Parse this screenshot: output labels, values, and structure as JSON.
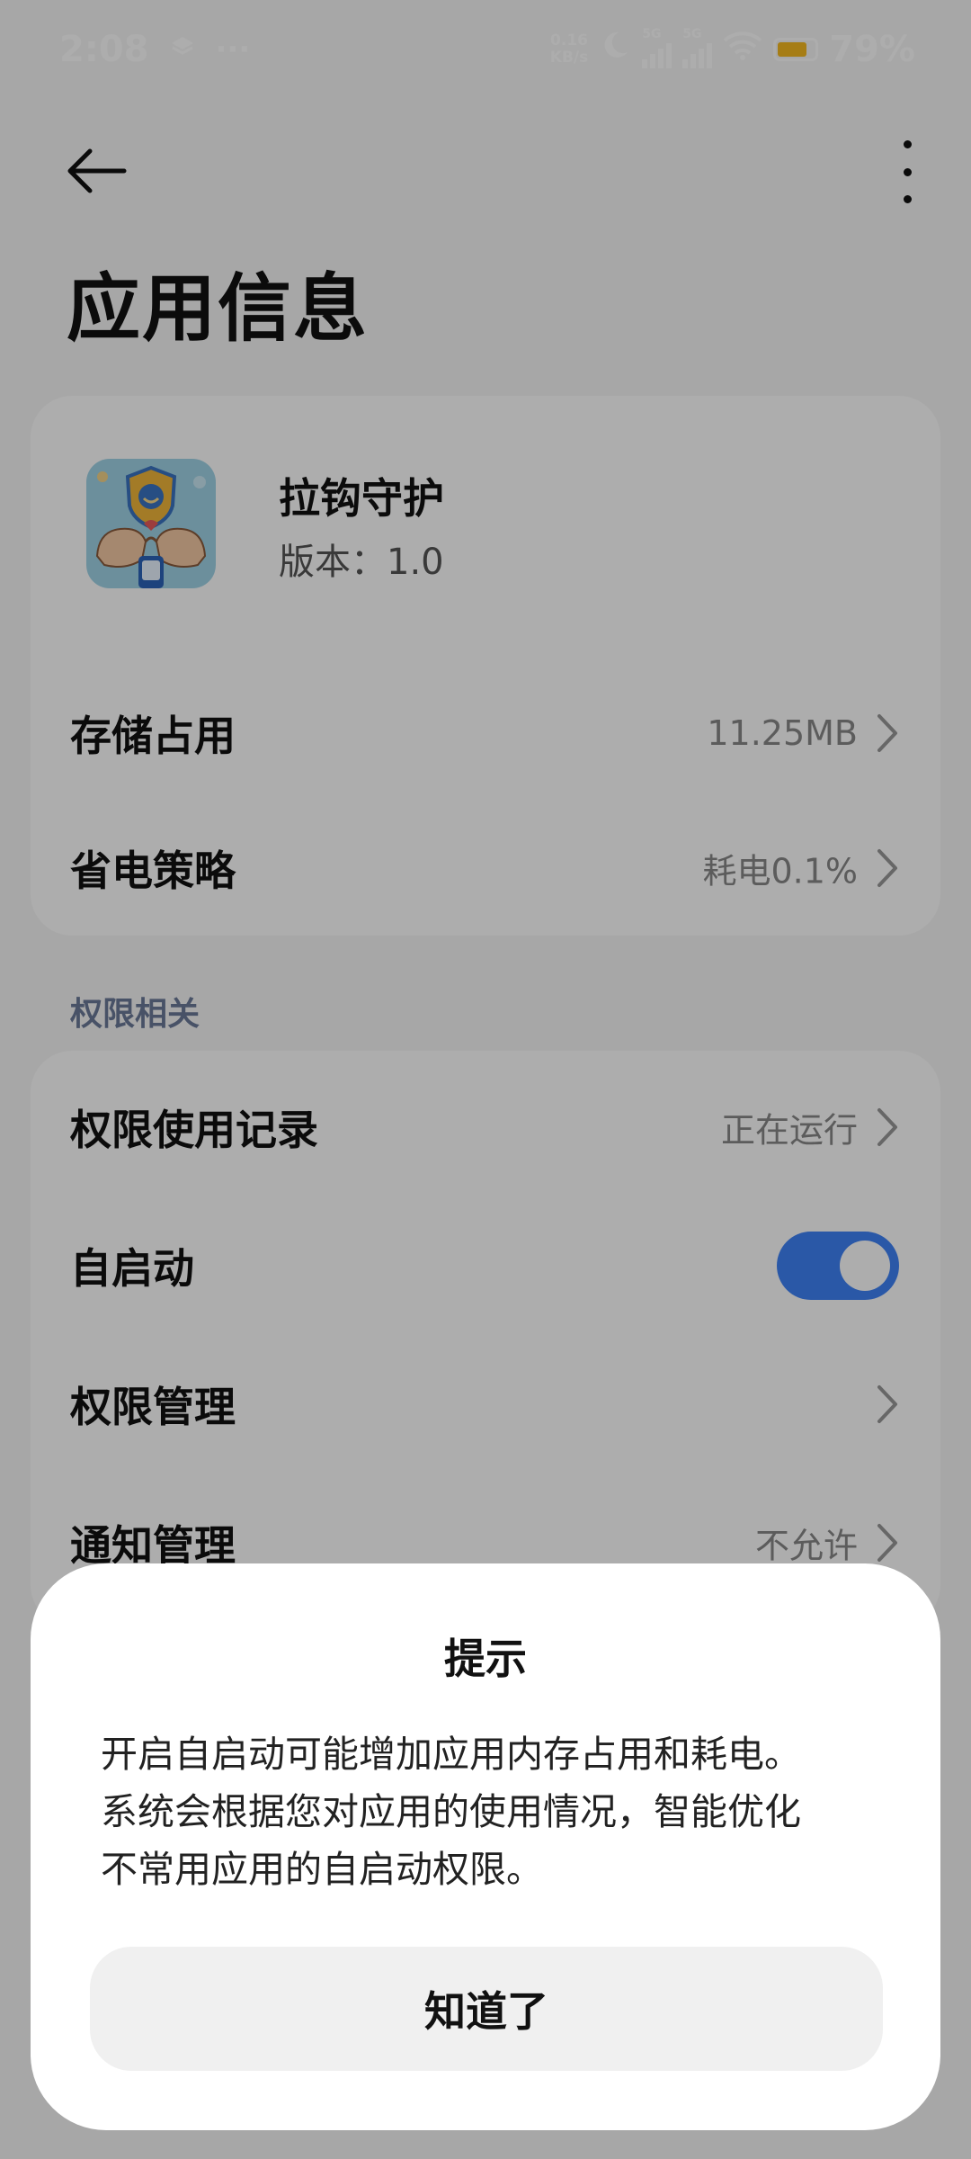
{
  "status_bar": {
    "time": "2:08",
    "netspeed_value": "0.16",
    "netspeed_unit": "KB/s",
    "sim1_tag": "5G",
    "sim2_tag": "5G",
    "battery_percent_text": "79%",
    "battery_level": 0.79,
    "battery_color": "#f5b820"
  },
  "header": {
    "page_title": "应用信息"
  },
  "app": {
    "name": "拉钩守护",
    "version": "版本：1.0"
  },
  "app_card": {
    "storage": {
      "label": "存储占用",
      "value": "11.25MB"
    },
    "battery": {
      "label": "省电策略",
      "value": "耗电0.1%"
    }
  },
  "permissions": {
    "section_title": "权限相关",
    "usage_record": {
      "label": "权限使用记录",
      "value": "正在运行"
    },
    "autostart": {
      "label": "自启动",
      "enabled": true
    },
    "manage": {
      "label": "权限管理"
    },
    "notification": {
      "label": "通知管理",
      "value": "不允许"
    }
  },
  "dialog": {
    "title": "提示",
    "message": "开启自启动可能增加应用内存占用和耗电。\n系统会根据您对应用的使用情况，智能优化\n不常用应用的自启动权限。",
    "confirm_label": "知道了"
  },
  "colors": {
    "accent": "#3f82f7",
    "section_header": "#6b7a99",
    "scrim": "rgba(0,0,0,0.32)"
  }
}
